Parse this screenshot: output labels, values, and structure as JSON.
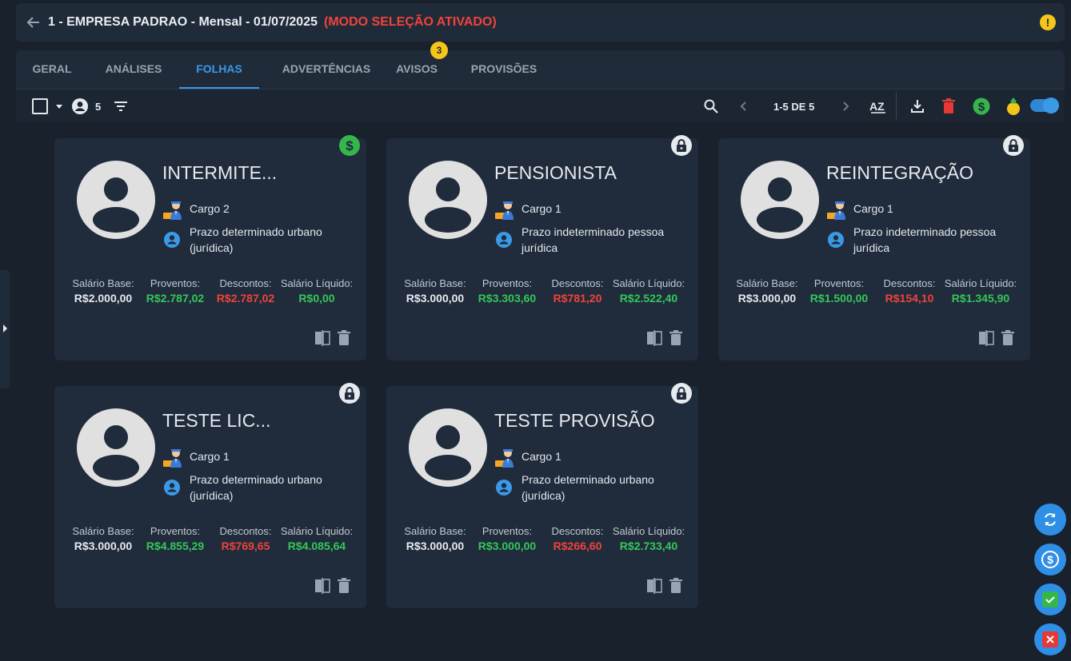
{
  "header": {
    "title": "1 - EMPRESA PADRAO - Mensal - 01/07/2025",
    "mode": "(MODO SELEÇÃO ATIVADO)",
    "warning_icon": "!"
  },
  "tabs": [
    {
      "label": "GERAL"
    },
    {
      "label": "ANÁLISES"
    },
    {
      "label": "FOLHAS"
    },
    {
      "label": "ADVERTÊNCIAS"
    },
    {
      "label": "AVISOS",
      "badge": "3"
    },
    {
      "label": "PROVISÕES"
    }
  ],
  "active_tab": "FOLHAS",
  "toolbar": {
    "employee_count": "5",
    "pagination": "1-5 DE 5",
    "sort_label": "AZ",
    "toggle_on": true
  },
  "colors": {
    "accent": "#3b9ae8",
    "positive": "#34c759",
    "negative": "#f0433a",
    "warning": "#f5c518",
    "card_bg": "#202b3b"
  },
  "labels": {
    "base": "Salário Base:",
    "proventos": "Proventos:",
    "descontos": "Descontos:",
    "liquido": "Salário Líquido:"
  },
  "cards": [
    {
      "name": "INTERMITE...",
      "cargo": "Cargo 2",
      "type": "Prazo determinado urbano (jurídica)",
      "badge": "dollar-icon",
      "base": "R$2.000,00",
      "proventos": "R$2.787,02",
      "descontos": "R$2.787,02",
      "liquido": "R$0,00"
    },
    {
      "name": "PENSIONISTA",
      "cargo": "Cargo 1",
      "type": "Prazo indeterminado pessoa jurídica",
      "badge": "lock-icon",
      "base": "R$3.000,00",
      "proventos": "R$3.303,60",
      "descontos": "R$781,20",
      "liquido": "R$2.522,40"
    },
    {
      "name": "REINTEGRAÇÃO",
      "cargo": "Cargo 1",
      "type": "Prazo indeterminado pessoa jurídica",
      "badge": "lock-icon",
      "base": "R$3.000,00",
      "proventos": "R$1.500,00",
      "descontos": "R$154,10",
      "liquido": "R$1.345,90"
    },
    {
      "name": "TESTE LIC...",
      "cargo": "Cargo 1",
      "type": "Prazo determinado urbano (jurídica)",
      "badge": "lock-icon",
      "base": "R$3.000,00",
      "proventos": "R$4.855,29",
      "descontos": "R$769,65",
      "liquido": "R$4.085,64"
    },
    {
      "name": "TESTE PROVISÃO",
      "cargo": "Cargo 1",
      "type": "Prazo determinado urbano (jurídica)",
      "badge": "lock-icon",
      "base": "R$3.000,00",
      "proventos": "R$3.000,00",
      "descontos": "R$266,60",
      "liquido": "R$2.733,40"
    }
  ],
  "fabs": [
    "refresh-icon",
    "dollar-icon",
    "confirm-icon",
    "cancel-icon"
  ]
}
